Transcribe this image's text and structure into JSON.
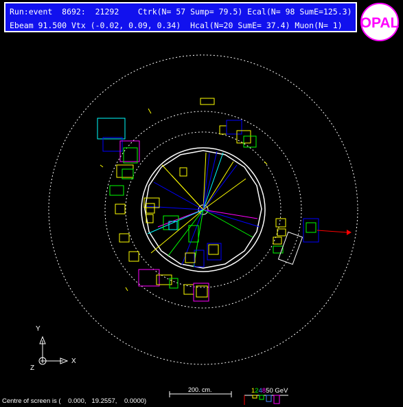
{
  "header": {
    "line1": "Run:event  8692:  21292    Ctrk(N= 57 Sump= 79.5) Ecal(N= 98 SumE=125.3)",
    "line2": "Ebeam 91.500 Vtx (-0.02, 0.09, 0.34)  Hcal(N=20 SumE= 37.4) Muon(N= 1)"
  },
  "logo": {
    "name": "opal-logo-icon",
    "text": "OPAL",
    "color": "#ff00ff"
  },
  "axes": {
    "y_label": "Y",
    "x_label": "X",
    "z_label": "Z"
  },
  "scale": {
    "label": "200. cm."
  },
  "energy_legend": {
    "values": [
      "1",
      "2",
      "4",
      "8"
    ],
    "unit": "50 GeV",
    "colors": [
      "#ffff00",
      "#00ff00",
      "#4488ff",
      "#ff00ff"
    ]
  },
  "footer": {
    "text": "Centre of screen is (    0.000,   19.2557,    0.0000)"
  },
  "colors": {
    "header_bg": "#1111ee",
    "tracks": [
      "#ffff00",
      "#0000ff",
      "#00ff00",
      "#ff00ff",
      "#00ffff"
    ],
    "muon_arrow": "#ff0000",
    "dashed_rings": "#ffffff"
  }
}
